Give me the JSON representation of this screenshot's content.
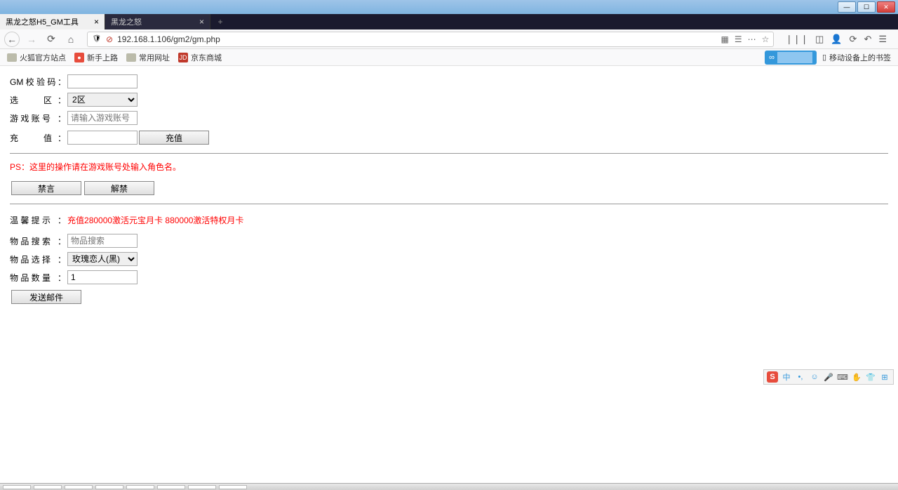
{
  "window": {
    "min": "—",
    "max": "☐",
    "close": "✕"
  },
  "tabs": {
    "active": "黑龙之怒H5_GM工具",
    "inactive": "黑龙之怒",
    "close": "×",
    "new": "+"
  },
  "nav": {
    "back": "←",
    "forward": "→",
    "reload": "⟳",
    "home": "⌂",
    "shield": "🛡",
    "insecure": "⊘",
    "url": "192.168.1.106/gm2/gm.php",
    "qr": "▦",
    "reader": "☰",
    "dots": "⋯",
    "star": "☆",
    "library": "❘❘❘",
    "sidebar": "◫",
    "account": "👤",
    "settings": "⟳",
    "undo": "↶",
    "menu": "☰"
  },
  "bookmarks": {
    "firefox": "火狐官方站点",
    "getting_started": "新手上路",
    "common": "常用网址",
    "jd": "京东商城",
    "mobile": "移动设备上的书签",
    "cloud_icon": "∞"
  },
  "form": {
    "gm_code_label": "GM 校 验 码",
    "zone_label": "选　　　区",
    "zone_value": "2区",
    "account_label": "游 戏 账 号",
    "account_placeholder": "请输入游戏账号",
    "recharge_label": "充　　　值",
    "recharge_btn": "充值",
    "ps_text": "PS：这里的操作请在游戏账号处输入角色名。",
    "ban_btn": "禁言",
    "unban_btn": "解禁",
    "tip_label": "温 馨 提 示",
    "tip_text": "充值280000激活元宝月卡 880000激活特权月卡",
    "search_label": "物 品 搜 索",
    "search_placeholder": "物品搜索",
    "item_select_label": "物 品 选 择",
    "item_select_value": "玫瑰恋人(黑)",
    "item_count_label": "物 品 数 量",
    "item_count_value": "1",
    "send_btn": "发送邮件",
    "colon": "："
  },
  "ime": {
    "s": "S",
    "zh": "中",
    "punct": "•,",
    "smile": "☺",
    "mic": "🎤",
    "keyboard": "⌨",
    "hand": "✋",
    "shirt": "👕",
    "grid": "⊞"
  }
}
